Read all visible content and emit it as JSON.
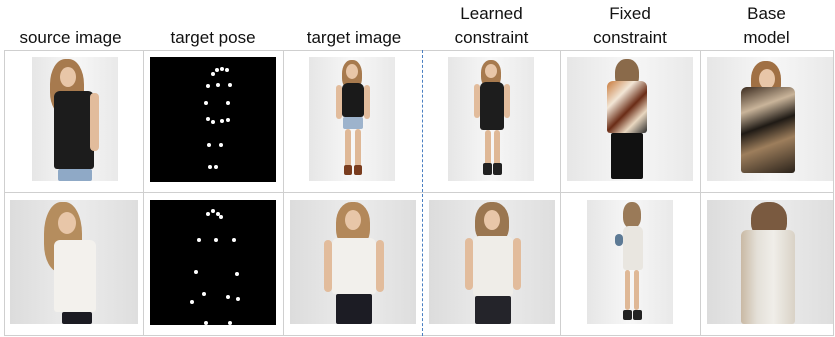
{
  "headers": {
    "source": "source image",
    "pose": "target pose",
    "target": "target image",
    "learned": "Learned\nconstraint",
    "fixed": "Fixed\nconstraint",
    "base": "Base\nmodel"
  },
  "colors": {
    "dashed_divider": "#4a7fc1",
    "grid_line": "#cfcfcf",
    "pose_background": "#000000",
    "keypoint": "#ffffff"
  }
}
